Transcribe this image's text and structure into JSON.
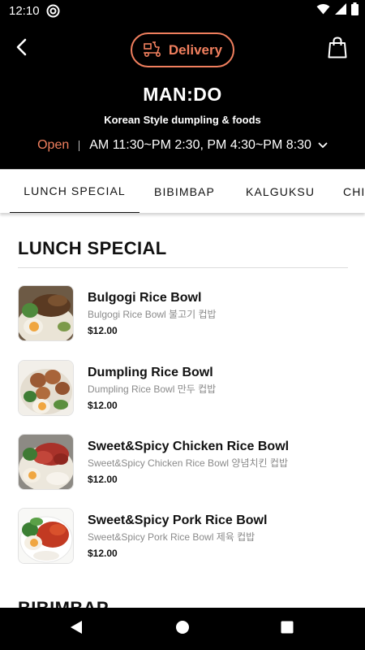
{
  "status_bar": {
    "time": "12:10",
    "icons": [
      "app-notification-icon",
      "wifi-icon",
      "cellular-signal-icon",
      "battery-icon"
    ]
  },
  "header": {
    "delivery_label": "Delivery",
    "store_name": "MAN:DO",
    "store_subtitle": "Korean Style dumpling & foods",
    "open_status": "Open",
    "hours": "AM 11:30~PM 2:30, PM 4:30~PM 8:30",
    "icons": [
      "back-arrow-icon",
      "scooter-icon",
      "shopping-bag-icon",
      "chevron-down-icon"
    ]
  },
  "tabs": [
    {
      "label": "LUNCH SPECIAL",
      "active": true
    },
    {
      "label": "BIBIMBAP",
      "active": false
    },
    {
      "label": "KALGUKSU",
      "active": false
    },
    {
      "label": "CHI",
      "active": false
    }
  ],
  "section": {
    "title": "LUNCH SPECIAL",
    "items": [
      {
        "name": "Bulgogi Rice Bowl",
        "description": "Bulgogi Rice Bowl 불고기 컵밥",
        "price": "$12.00"
      },
      {
        "name": "Dumpling Rice Bowl",
        "description": "Dumpling Rice Bowl 만두 컵밥",
        "price": "$12.00"
      },
      {
        "name": "Sweet&Spicy Chicken Rice Bowl",
        "description": "Sweet&Spicy Chicken Rice Bowl 양념치킨 컵밥",
        "price": "$12.00"
      },
      {
        "name": "Sweet&Spicy Pork Rice Bowl",
        "description": "Sweet&Spicy Pork Rice Bowl 제육 컵밥",
        "price": "$12.00"
      }
    ]
  },
  "next_section": {
    "title": "BIBIMBAP"
  },
  "nav_bar": {
    "icons": [
      "back-triangle-icon",
      "home-circle-icon",
      "recents-square-icon"
    ]
  },
  "colors": {
    "accent": "#f07f5e",
    "header_bg": "#000000",
    "text": "#111111",
    "muted": "#8a8a8a"
  }
}
